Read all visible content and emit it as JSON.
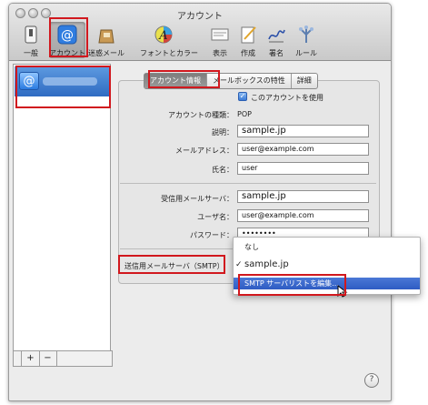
{
  "window": {
    "title": "アカウント"
  },
  "toolbar": [
    {
      "id": "general",
      "label": "一般",
      "icon": "switch-icon"
    },
    {
      "id": "accounts",
      "label": "アカウント",
      "icon": "at-icon",
      "selected": true
    },
    {
      "id": "junk",
      "label": "迷惑メール",
      "icon": "junk-bag-icon"
    },
    {
      "id": "fonts",
      "label": "フォントとカラー",
      "icon": "font-icon"
    },
    {
      "id": "viewing",
      "label": "表示",
      "icon": "viewing-icon"
    },
    {
      "id": "composing",
      "label": "作成",
      "icon": "compose-icon"
    },
    {
      "id": "signatures",
      "label": "署名",
      "icon": "signature-icon"
    },
    {
      "id": "rules",
      "label": "ルール",
      "icon": "rules-icon"
    }
  ],
  "sidebar": {
    "add_label": "+",
    "remove_label": "−"
  },
  "tabs": [
    "アカウント情報",
    "メールボックスの特性",
    "詳細"
  ],
  "account": {
    "enable_label": "このアカウントを使用",
    "type_label": "アカウントの種類：",
    "type_value": "POP",
    "description_label": "説明：",
    "description_value": "sample.jp",
    "email_label": "メールアドレス：",
    "email_value": "user@example.com",
    "name_label": "氏名：",
    "name_value": "user",
    "incoming_label": "受信用メールサーバ：",
    "incoming_value": "sample.jp",
    "username_label": "ユーザ名：",
    "username_value": "user@example.com",
    "password_label": "パスワード：",
    "password_value": "••••••••",
    "smtp_label": "送信用メールサーバ（SMTP）"
  },
  "smtp_menu": {
    "items": [
      "なし",
      "sample.jp",
      "SMTP サーバリストを編集..."
    ],
    "checked_index": 1,
    "highlighted_index": 2
  },
  "help_label": "?",
  "colors": {
    "highlight": "#d1181e",
    "selection": "#3566c8"
  }
}
